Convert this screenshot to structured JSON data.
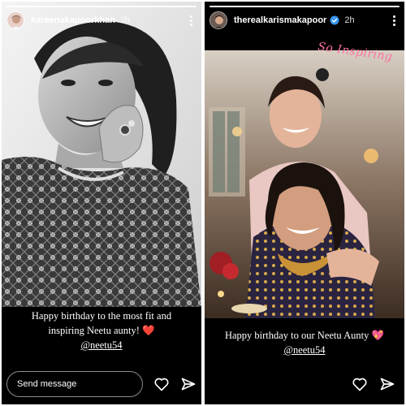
{
  "stories": [
    {
      "username": "kareenakapoorkhan",
      "time": "2h",
      "caption_line1": "Happy birthday to the most fit and",
      "caption_line2": "inspiring Neetu aunty!",
      "caption_emoji": "❤️",
      "mention": "@neetu54",
      "progress": 1,
      "photo_style": "black-and-white portrait",
      "send_placeholder": "Send message",
      "icons": [
        "more-icon",
        "heart-icon",
        "send-icon"
      ]
    },
    {
      "username": "therealkarismakapoor",
      "time": "2h",
      "sticker": "So Inspiring",
      "caption_line1": "Happy birthday to our Neetu Aunty",
      "caption_emoji": "💖",
      "mention": "@neetu54",
      "progress": 1,
      "photo_style": "warm indoor color photo",
      "icons": [
        "more-icon",
        "heart-icon",
        "send-icon"
      ]
    }
  ],
  "colors": {
    "background": "#000000",
    "text": "#ffffff",
    "heart_red": "#e0245e",
    "sticker_pink": "#ff6fa0"
  }
}
